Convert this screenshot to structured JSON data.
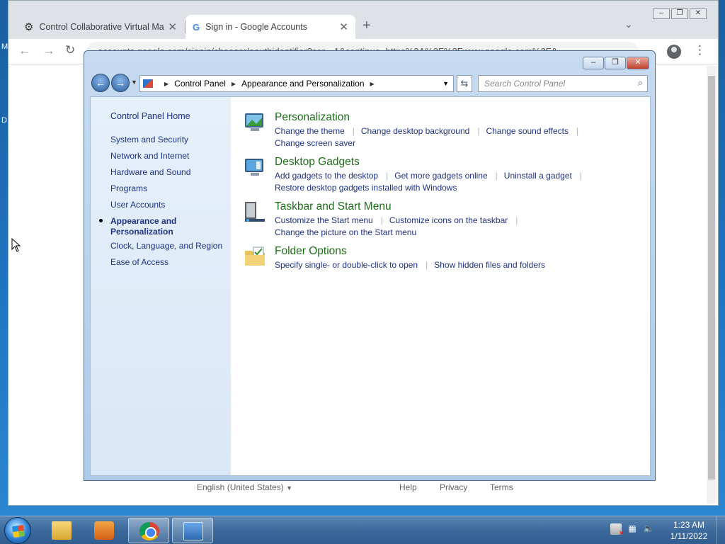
{
  "desktop": {
    "side_letters": [
      "M",
      "D"
    ]
  },
  "browser": {
    "tabs": [
      {
        "title": "Control Collaborative Virtual Ma",
        "icon": "cog-icon"
      },
      {
        "title": "Sign in - Google Accounts",
        "icon": "google-icon",
        "active": true
      }
    ],
    "url": "accounts.google.com/signin/chooser/oauthidentifier?scp...1&continue=https%3A%2F%2Fwww.google.com%2F&...",
    "footer": {
      "language": "English (United States)",
      "help": "Help",
      "privacy": "Privacy",
      "terms": "Terms"
    }
  },
  "control_panel": {
    "breadcrumb": [
      "Control Panel",
      "Appearance and Personalization"
    ],
    "search_placeholder": "Search Control Panel",
    "sidebar": {
      "home": "Control Panel Home",
      "items": [
        "System and Security",
        "Network and Internet",
        "Hardware and Sound",
        "Programs",
        "User Accounts",
        "Appearance and Personalization",
        "Clock, Language, and Region",
        "Ease of Access"
      ],
      "selected_index": 5
    },
    "categories": [
      {
        "title": "Personalization",
        "icon": "personalization-icon",
        "links": [
          "Change the theme",
          "Change desktop background",
          "Change sound effects",
          "Change screen saver"
        ]
      },
      {
        "title": "Desktop Gadgets",
        "icon": "gadgets-icon",
        "links": [
          "Add gadgets to the desktop",
          "Get more gadgets online",
          "Uninstall a gadget",
          "Restore desktop gadgets installed with Windows"
        ]
      },
      {
        "title": "Taskbar and Start Menu",
        "icon": "taskbar-icon",
        "links": [
          "Customize the Start menu",
          "Customize icons on the taskbar",
          "Change the picture on the Start menu"
        ]
      },
      {
        "title": "Folder Options",
        "icon": "folder-options-icon",
        "links": [
          "Specify single- or double-click to open",
          "Show hidden files and folders"
        ]
      }
    ]
  },
  "taskbar": {
    "clock_time": "1:23 AM",
    "clock_date": "1/11/2022"
  }
}
